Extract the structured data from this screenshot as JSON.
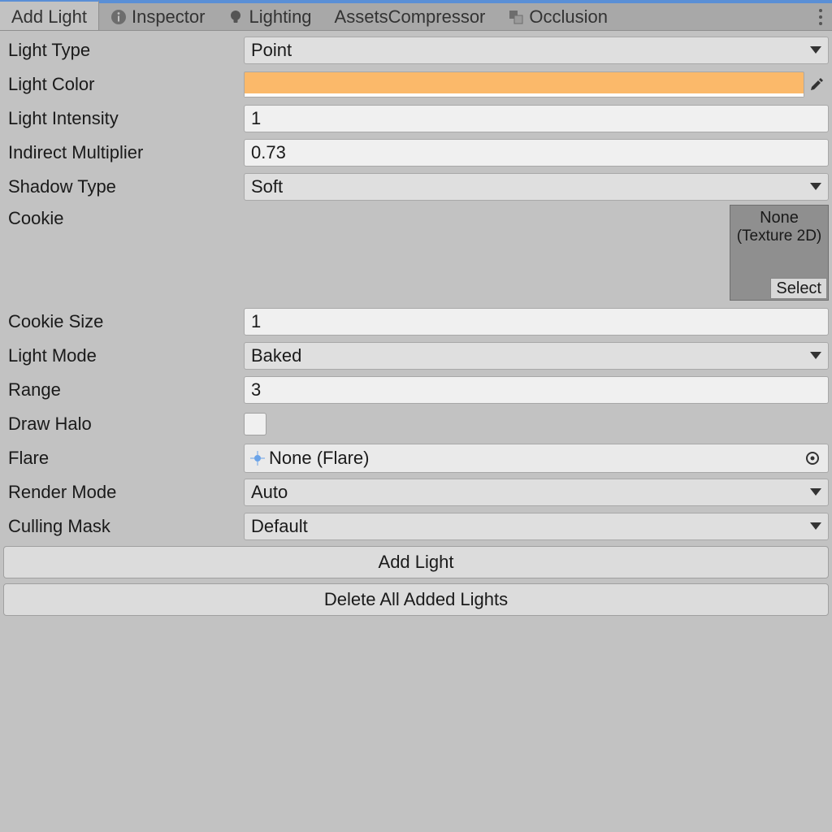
{
  "tabs": {
    "add_light": "Add Light",
    "inspector": "Inspector",
    "lighting": "Lighting",
    "assets_compressor": "AssetsCompressor",
    "occlusion": "Occlusion"
  },
  "labels": {
    "light_type": "Light Type",
    "light_color": "Light Color",
    "light_intensity": "Light Intensity",
    "indirect_multiplier": "Indirect Multiplier",
    "shadow_type": "Shadow Type",
    "cookie": "Cookie",
    "cookie_size": "Cookie Size",
    "light_mode": "Light Mode",
    "range": "Range",
    "draw_halo": "Draw Halo",
    "flare": "Flare",
    "render_mode": "Render Mode",
    "culling_mask": "Culling Mask"
  },
  "values": {
    "light_type": "Point",
    "light_color_hex": "#fbb96a",
    "light_intensity": "1",
    "indirect_multiplier": "0.73",
    "shadow_type": "Soft",
    "cookie_none": "None",
    "cookie_type": "(Texture 2D)",
    "cookie_select": "Select",
    "cookie_size": "1",
    "light_mode": "Baked",
    "range": "3",
    "draw_halo_checked": false,
    "flare": "None (Flare)",
    "render_mode": "Auto",
    "culling_mask": "Default"
  },
  "buttons": {
    "add_light": "Add Light",
    "delete_all": "Delete All Added Lights"
  }
}
